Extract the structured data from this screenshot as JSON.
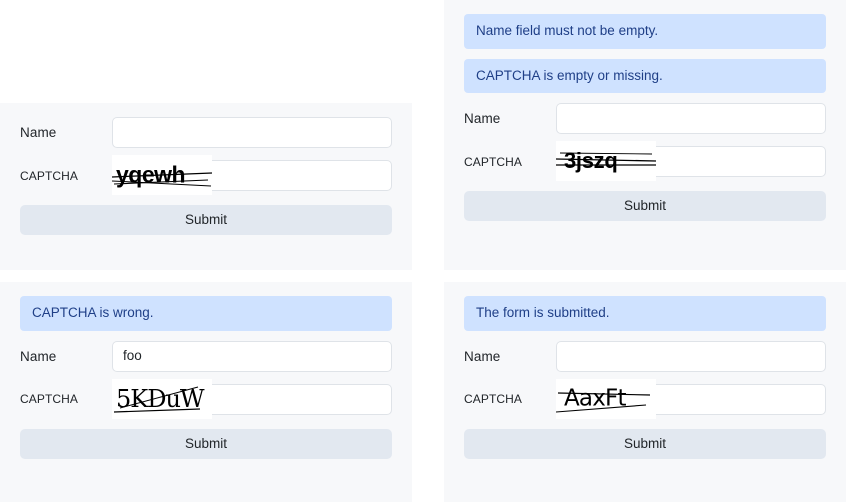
{
  "theme": {
    "page_bg": "#ffffff",
    "panel_bg": "#f7f8fa",
    "alert_bg": "#cfe2ff",
    "alert_text": "#1f3f87",
    "input_bg": "#ffffff",
    "input_border": "#dfe3e8",
    "button_bg": "#e2e8f0",
    "text": "#212529"
  },
  "labels": {
    "name": "Name",
    "captcha": "CAPTCHA",
    "submit": "Submit",
    "name_placeholder": "",
    "captcha_placeholder": ""
  },
  "panels": [
    {
      "id": "panel-initial",
      "alerts": [],
      "name_value": "",
      "captcha_value": "",
      "captcha_image_text": "yqewh",
      "captcha_style": "bold-strikethrough",
      "submit_label": "Submit"
    },
    {
      "id": "panel-empty-errors",
      "alerts": [
        "Name field must not be empty.",
        "CAPTCHA is empty or missing."
      ],
      "name_value": "",
      "captcha_value": "",
      "captcha_image_text": "3jszq",
      "captcha_style": "bold-strikethrough",
      "submit_label": "Submit"
    },
    {
      "id": "panel-wrong-captcha",
      "alerts": [
        "CAPTCHA is wrong."
      ],
      "name_value": "foo",
      "captcha_value": "",
      "captcha_image_text": "5KDuW",
      "captcha_style": "thin-underline",
      "submit_label": "Submit"
    },
    {
      "id": "panel-submitted",
      "alerts": [
        "The form is submitted."
      ],
      "name_value": "",
      "captcha_value": "",
      "captcha_image_text": "AaxFt",
      "captcha_style": "outline-strikethrough",
      "submit_label": "Submit"
    }
  ]
}
